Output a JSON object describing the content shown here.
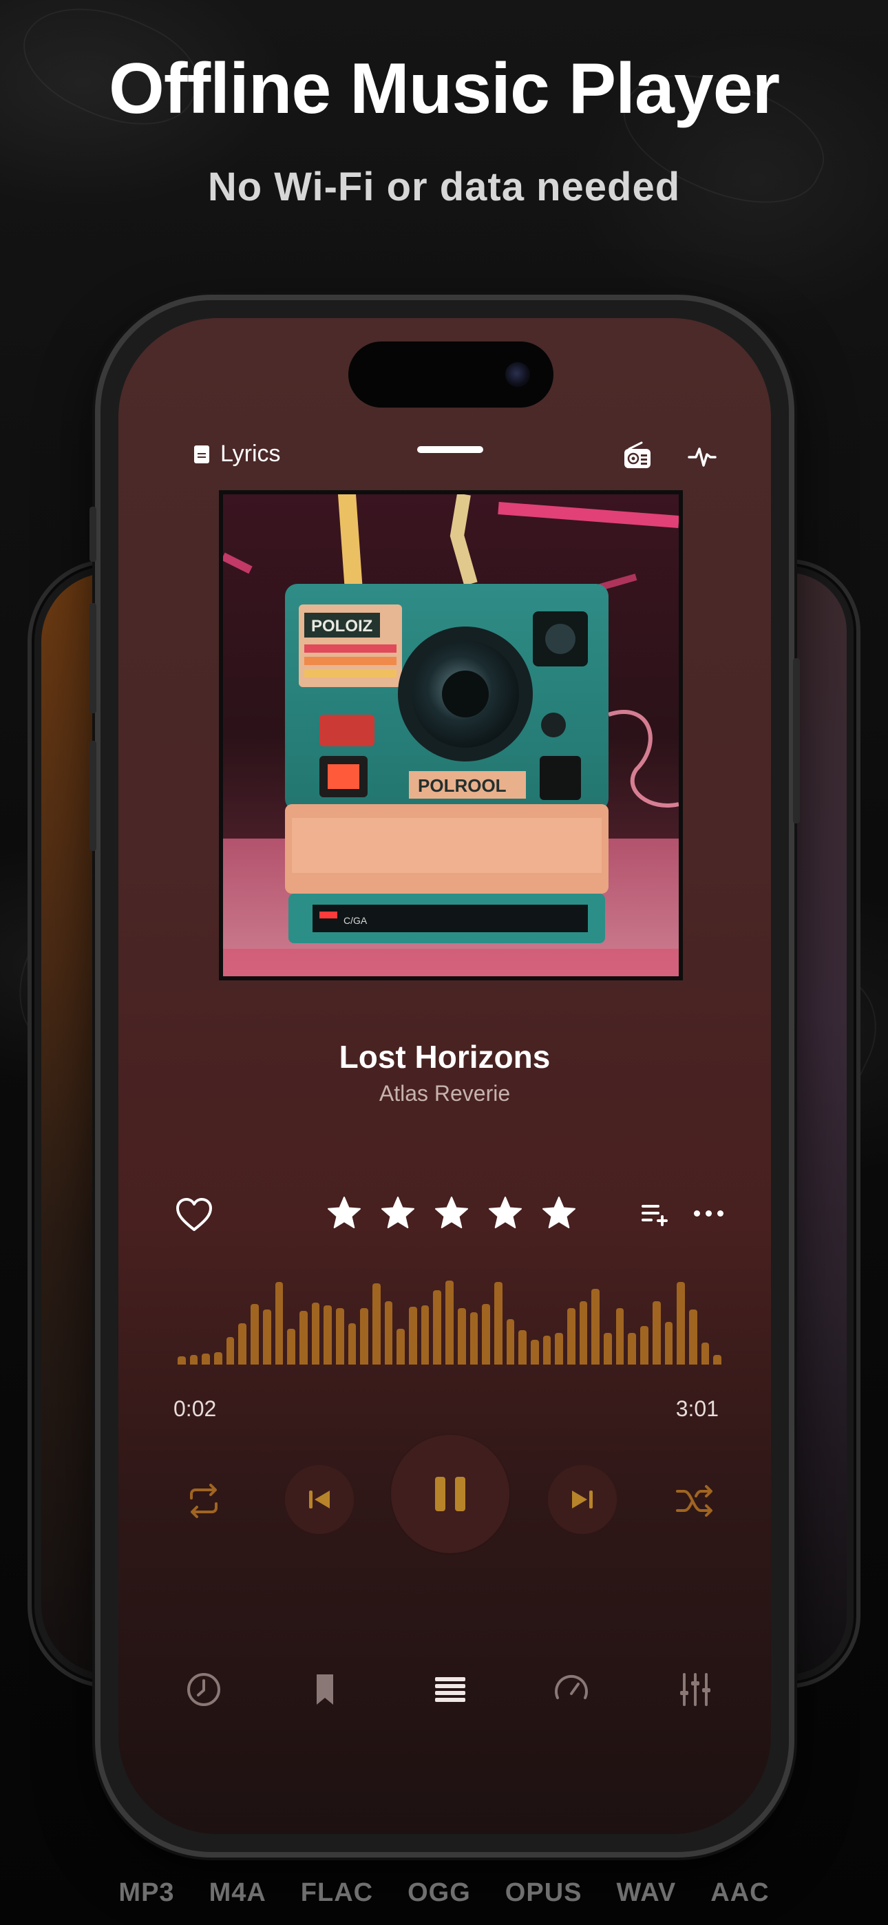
{
  "hero": {
    "title": "Offline Music Player",
    "subtitle": "No Wi-Fi or data needed"
  },
  "player": {
    "lyrics_label": "Lyrics",
    "song_title": "Lost Horizons",
    "artist": "Atlas Reverie",
    "rating": 5,
    "rating_max": 5,
    "elapsed": "0:02",
    "duration": "3:01",
    "progress": 0.011,
    "is_playing": true
  },
  "artwork": {
    "label_top": "POLOIZ",
    "label_front": "POLROOL",
    "label_bottom": "C/GA"
  },
  "icons": {
    "lyrics": "document-icon",
    "radio": "radio-icon",
    "visualizer": "pulse-icon",
    "favorite": "heart-icon",
    "queue": "add-to-queue-icon",
    "more": "more-icon",
    "repeat": "repeat-icon",
    "previous": "previous-icon",
    "pause": "pause-icon",
    "next": "next-icon",
    "shuffle": "shuffle-icon"
  },
  "tabs": [
    {
      "id": "history",
      "icon": "clock-icon"
    },
    {
      "id": "bookmarks",
      "icon": "bookmark-icon"
    },
    {
      "id": "library",
      "icon": "library-icon",
      "active": true
    },
    {
      "id": "speed",
      "icon": "speedometer-icon"
    },
    {
      "id": "equalizer",
      "icon": "equalizer-icon"
    }
  ],
  "formats": [
    "MP3",
    "M4A",
    "FLAC",
    "OGG",
    "OPUS",
    "WAV",
    "AAC"
  ],
  "colors": {
    "accent": "#a06521",
    "play_accent": "#b8842a",
    "screen_bg": "#4b2a29"
  }
}
